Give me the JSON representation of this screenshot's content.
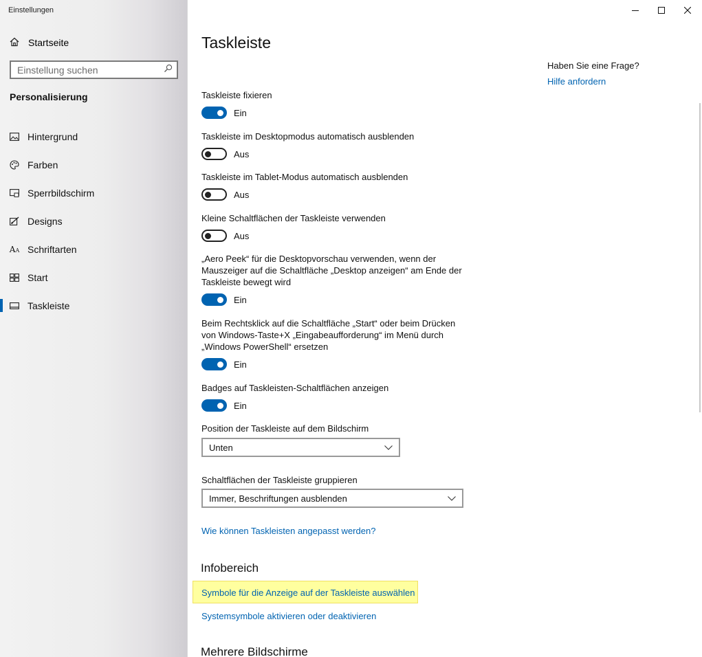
{
  "app": {
    "title": "Einstellungen"
  },
  "sidebar": {
    "home_label": "Startseite",
    "search_placeholder": "Einstellung suchen",
    "section_title": "Personalisierung",
    "items": [
      {
        "label": "Hintergrund",
        "icon": "picture-icon"
      },
      {
        "label": "Farben",
        "icon": "palette-icon"
      },
      {
        "label": "Sperrbildschirm",
        "icon": "lock-screen-icon"
      },
      {
        "label": "Designs",
        "icon": "brush-icon"
      },
      {
        "label": "Schriftarten",
        "icon": "font-icon"
      },
      {
        "label": "Start",
        "icon": "start-icon"
      },
      {
        "label": "Taskleiste",
        "icon": "taskbar-icon",
        "active": true
      }
    ]
  },
  "main": {
    "title": "Taskleiste",
    "settings": [
      {
        "label": "Taskleiste fixieren",
        "state": "Ein",
        "on": true
      },
      {
        "label": "Taskleiste im Desktopmodus automatisch ausblenden",
        "state": "Aus",
        "on": false
      },
      {
        "label": "Taskleiste im Tablet-Modus automatisch ausblenden",
        "state": "Aus",
        "on": false
      },
      {
        "label": "Kleine Schaltflächen der Taskleiste verwenden",
        "state": "Aus",
        "on": false
      },
      {
        "label": "„Aero Peek“ für die Desktopvorschau verwenden, wenn der Mauszeiger auf die Schaltfläche „Desktop anzeigen“ am Ende der Taskleiste bewegt wird",
        "state": "Ein",
        "on": true
      },
      {
        "label": "Beim Rechtsklick auf die Schaltfläche „Start“ oder beim Drücken von Windows-Taste+X „Eingabeaufforderung“ im Menü durch „Windows PowerShell“ ersetzen",
        "state": "Ein",
        "on": true
      },
      {
        "label": "Badges auf Taskleisten-Schaltflächen anzeigen",
        "state": "Ein",
        "on": true
      }
    ],
    "position": {
      "label": "Position der Taskleiste auf dem Bildschirm",
      "value": "Unten"
    },
    "grouping": {
      "label": "Schaltflächen der Taskleiste gruppieren",
      "value": "Immer, Beschriftungen ausblenden"
    },
    "customize_link": "Wie können Taskleisten angepasst werden?",
    "infobereich": {
      "heading": "Infobereich",
      "select_icons_link": "Symbole für die Anzeige auf der Taskleiste auswählen",
      "system_icons_link": "Systemsymbole aktivieren oder deaktivieren"
    },
    "multi_monitor_heading": "Mehrere Bildschirme"
  },
  "help": {
    "question": "Haben Sie eine Frage?",
    "link": "Hilfe anfordern"
  },
  "colors": {
    "accent": "#0063b1",
    "highlight": "#ffff9f"
  }
}
